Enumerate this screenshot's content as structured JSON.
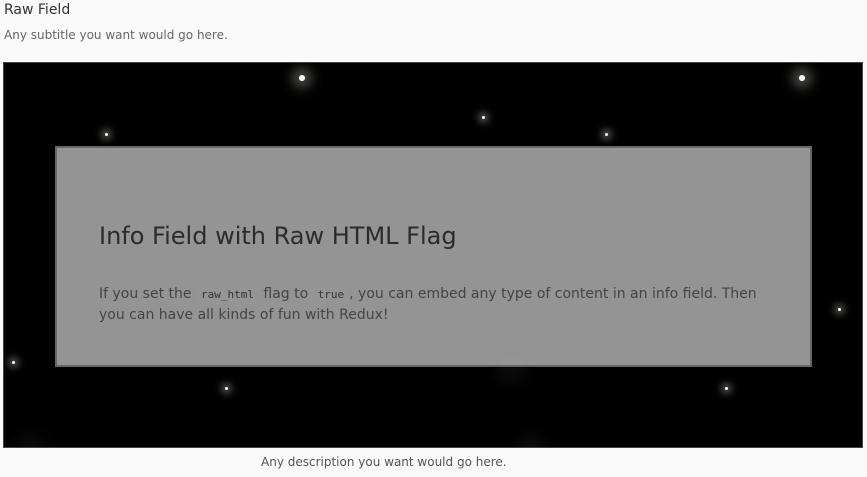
{
  "field": {
    "title": "Raw Field",
    "subtitle": "Any subtitle you want would go here.",
    "description": "Any description you want would go here."
  },
  "info": {
    "heading": "Info Field with Raw HTML Flag",
    "body_text_1": "If you set the ",
    "code_1": "raw_html",
    "body_text_2": " flag to ",
    "code_2": "true",
    "body_text_3": ", you can embed any type of content in an info field. Then you can have all kinds of fun with Redux!"
  },
  "colors": {
    "stage_background": "#000000",
    "panel_background": "#b4b4b4",
    "star": "#ffffff"
  }
}
